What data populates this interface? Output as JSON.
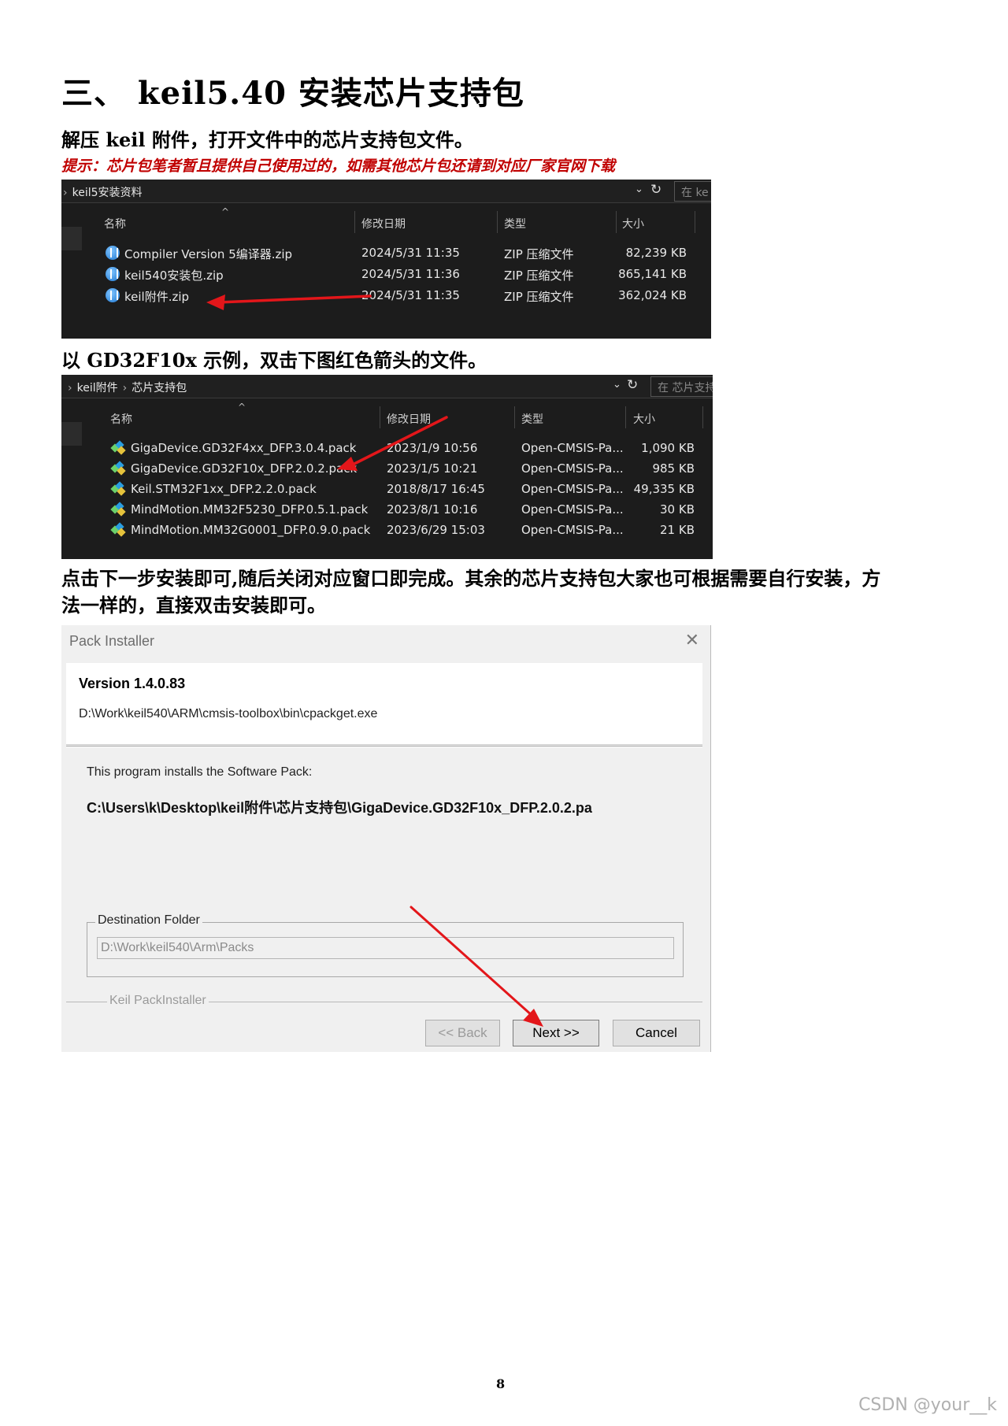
{
  "heading": "三、 keil5.40 安装芯片支持包",
  "para1": "解压 keil 附件，打开文件中的芯片支持包文件。",
  "hint": "提示：芯片包笔者暂且提供自己使用过的，如需其他芯片包还请到对应厂家官网下载",
  "explorer1": {
    "breadcrumb": "keil5安装资料",
    "search_placeholder": "在 ke",
    "columns": {
      "name": "名称",
      "date": "修改日期",
      "type": "类型",
      "size": "大小"
    },
    "rows": [
      {
        "name": "Compiler Version 5编译器.zip",
        "date": "2024/5/31 11:35",
        "type": "ZIP 压缩文件",
        "size": "82,239 KB"
      },
      {
        "name": "keil540安装包.zip",
        "date": "2024/5/31 11:36",
        "type": "ZIP 压缩文件",
        "size": "865,141 KB"
      },
      {
        "name": "keil附件.zip",
        "date": "2024/5/31 11:35",
        "type": "ZIP 压缩文件",
        "size": "362,024 KB"
      }
    ]
  },
  "para2": "以 GD32F10x 示例，双击下图红色箭头的文件。",
  "explorer2": {
    "crumb1": "keil附件",
    "crumb2": "芯片支持包",
    "search_placeholder": "在 芯片支持",
    "columns": {
      "name": "名称",
      "date": "修改日期",
      "type": "类型",
      "size": "大小"
    },
    "rows": [
      {
        "name": "GigaDevice.GD32F4xx_DFP.3.0.4.pack",
        "date": "2023/1/9 10:56",
        "type": "Open-CMSIS-Pa...",
        "size": "1,090 KB"
      },
      {
        "name": "GigaDevice.GD32F10x_DFP.2.0.2.pack",
        "date": "2023/1/5 10:21",
        "type": "Open-CMSIS-Pa...",
        "size": "985 KB"
      },
      {
        "name": "Keil.STM32F1xx_DFP.2.2.0.pack",
        "date": "2018/8/17 16:45",
        "type": "Open-CMSIS-Pa...",
        "size": "49,335 KB"
      },
      {
        "name": "MindMotion.MM32F5230_DFP.0.5.1.pack",
        "date": "2023/8/1 10:16",
        "type": "Open-CMSIS-Pa...",
        "size": "30 KB"
      },
      {
        "name": "MindMotion.MM32G0001_DFP.0.9.0.pack",
        "date": "2023/6/29 15:03",
        "type": "Open-CMSIS-Pa...",
        "size": "21 KB"
      }
    ]
  },
  "para3_line1": "点击下一步安装即可,随后关闭对应窗口即完成。其余的芯片支持包大家也可根据需要自行安装，方",
  "para3_line2": "法一样的，直接双击安装即可。",
  "dialog": {
    "title": "Pack Installer",
    "close": "✕",
    "version": "Version 1.4.0.83",
    "path": "D:\\Work\\keil540\\ARM\\cmsis-toolbox\\bin\\cpackget.exe",
    "info": "This program installs the Software Pack:",
    "file": "C:\\Users\\k\\Desktop\\keil附件\\芯片支持包\\GigaDevice.GD32F10x_DFP.2.0.2.pa",
    "dest_label": "Destination Folder",
    "dest_value": "D:\\Work\\keil540\\Arm\\Packs",
    "brand": "Keil PackInstaller",
    "back": "<< Back",
    "next": "Next >>",
    "cancel": "Cancel"
  },
  "page_number": "8",
  "watermark": "CSDN @your__k",
  "colors": {
    "arrow": "#e3161a",
    "hint": "#c00000",
    "explorer_bg": "#1c1c1c",
    "dialog_bg": "#f0f0f0"
  }
}
